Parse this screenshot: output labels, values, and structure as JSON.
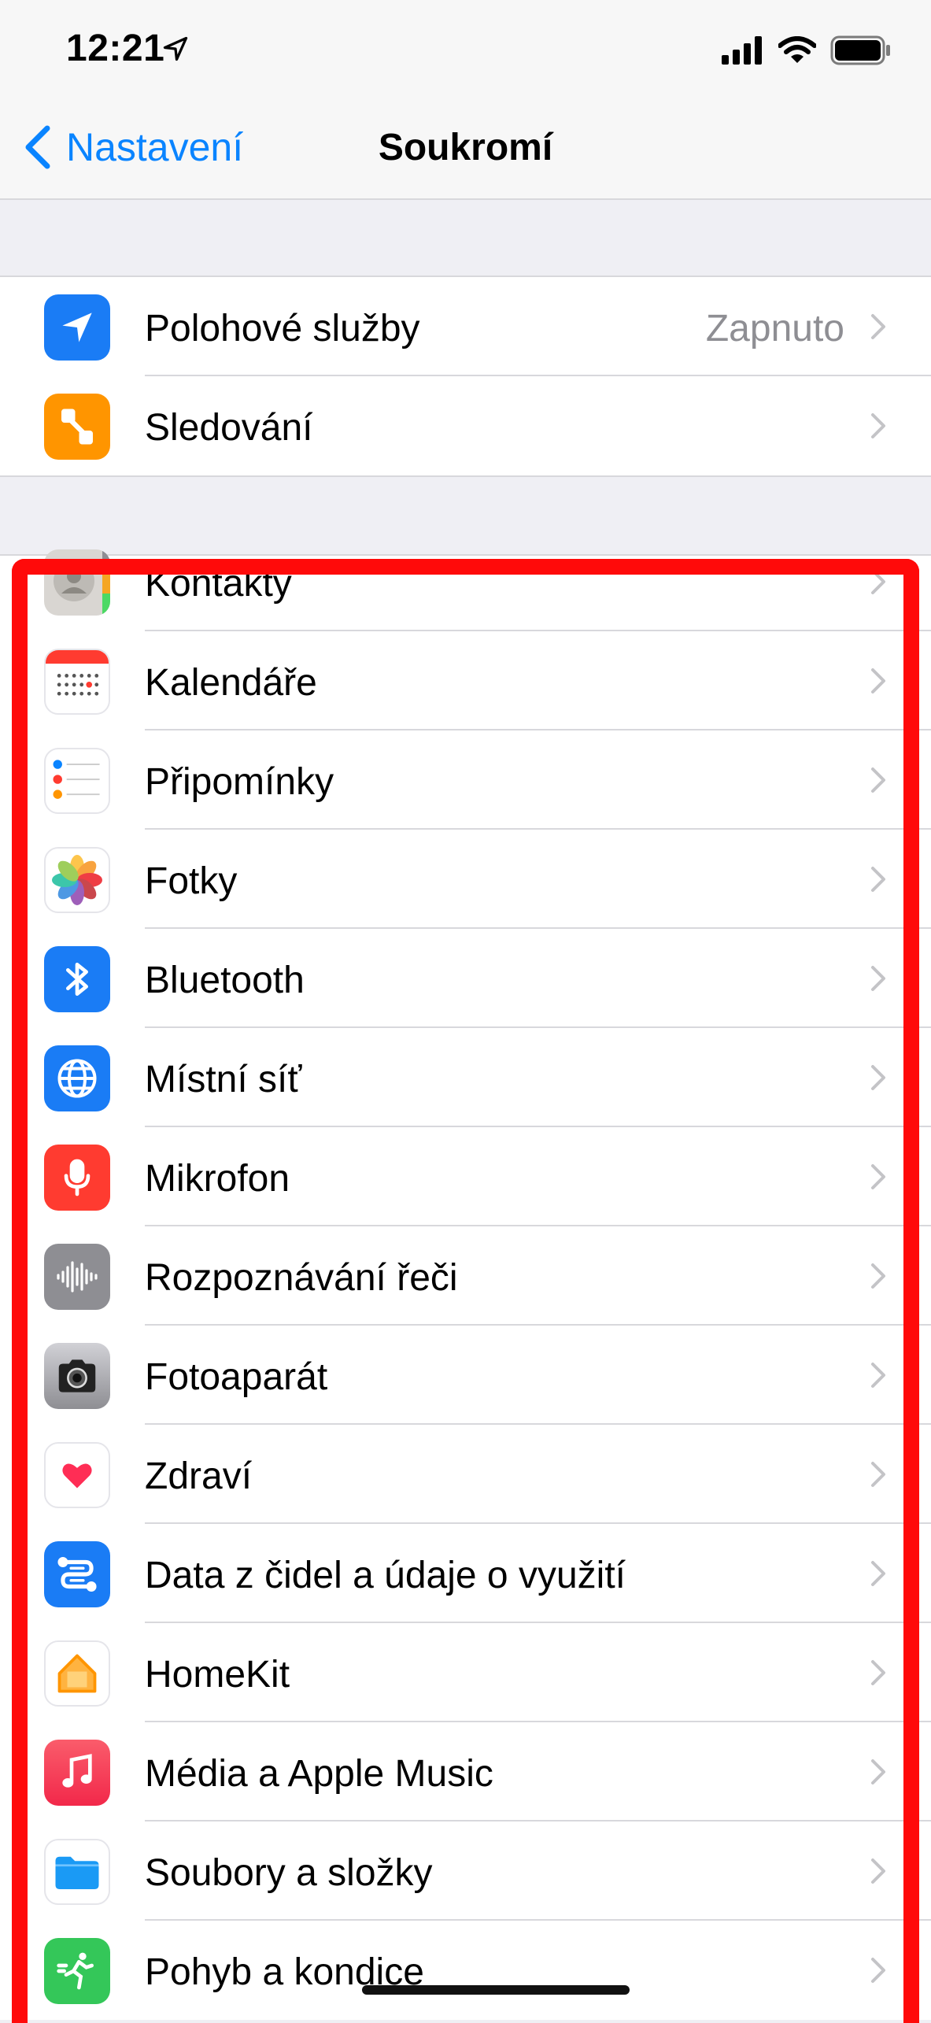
{
  "status_bar": {
    "time": "12:21"
  },
  "nav": {
    "back_label": "Nastavení",
    "title": "Soukromí"
  },
  "group1": [
    {
      "label": "Polohové služby",
      "value": "Zapnuto",
      "icon": "location-arrow-icon",
      "color": "#1a7cf5"
    },
    {
      "label": "Sledování",
      "icon": "tracking-icon",
      "color": "#ff9500"
    }
  ],
  "group2": [
    {
      "label": "Kontakty",
      "icon": "contacts-icon"
    },
    {
      "label": "Kalendáře",
      "icon": "calendar-icon"
    },
    {
      "label": "Připomínky",
      "icon": "reminders-icon"
    },
    {
      "label": "Fotky",
      "icon": "photos-icon"
    },
    {
      "label": "Bluetooth",
      "icon": "bluetooth-icon",
      "color": "#1a7cf5"
    },
    {
      "label": "Místní síť",
      "icon": "globe-icon",
      "color": "#1a7cf5"
    },
    {
      "label": "Mikrofon",
      "icon": "microphone-icon",
      "color": "#ff3b30"
    },
    {
      "label": "Rozpoznávání řeči",
      "icon": "waveform-icon",
      "color": "#8e8e93"
    },
    {
      "label": "Fotoaparát",
      "icon": "camera-icon",
      "color": "#8e8e93"
    },
    {
      "label": "Zdraví",
      "icon": "heart-icon",
      "color": "#ff2d55"
    },
    {
      "label": "Data z čidel a údaje o využití",
      "icon": "sensor-data-icon",
      "color": "#1a7cf5"
    },
    {
      "label": "HomeKit",
      "icon": "home-icon",
      "color": "#ff9f0a"
    },
    {
      "label": "Média a Apple Music",
      "icon": "music-note-icon",
      "color": "#fc3c44"
    },
    {
      "label": "Soubory a složky",
      "icon": "folder-icon",
      "color": "#1a9af5"
    },
    {
      "label": "Pohyb a kondice",
      "icon": "fitness-icon",
      "color": "#34c759"
    }
  ],
  "colors": {
    "accent": "#0a84ff",
    "highlight_border": "#ff0a0a"
  }
}
